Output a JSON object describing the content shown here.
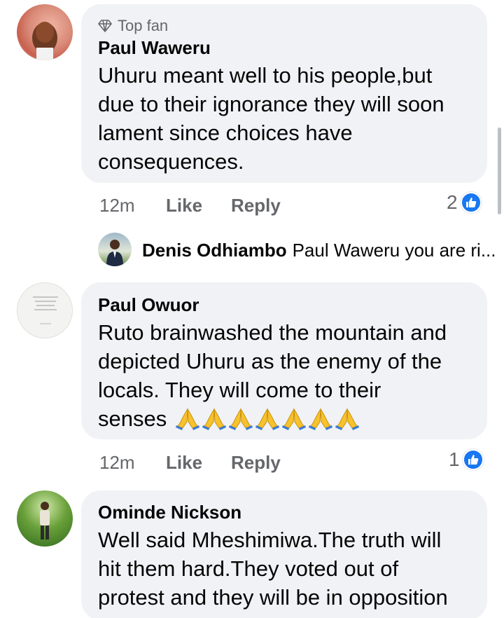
{
  "comments": [
    {
      "badge": "Top fan",
      "author": "Paul Waweru",
      "text_lines": [
        "Uhuru meant well to his people,but",
        "due to their ignorance they will soon",
        "lament since choices have",
        "consequences."
      ],
      "time": "12m",
      "like_label": "Like",
      "reply_label": "Reply",
      "reaction_count": "2",
      "reply": {
        "author": "Denis Odhiambo",
        "snippet": "Paul Waweru you are ri..."
      }
    },
    {
      "author": "Paul Owuor",
      "text_lines": [
        "Ruto brainwashed the mountain and",
        "depicted Uhuru as the enemy of the",
        "locals. They will come to their",
        "senses"
      ],
      "emoji": "folded-hands",
      "emoji_count": 7,
      "time": "12m",
      "like_label": "Like",
      "reply_label": "Reply",
      "reaction_count": "1"
    },
    {
      "author": "Ominde Nickson",
      "text_lines": [
        "Well said Mheshimiwa.The truth will",
        "hit them hard.They voted out of",
        "protest and they will be in opposition"
      ]
    }
  ],
  "colors": {
    "bubble": "#f0f2f5",
    "like_blue": "#1877f2",
    "meta_gray": "#65676b"
  }
}
